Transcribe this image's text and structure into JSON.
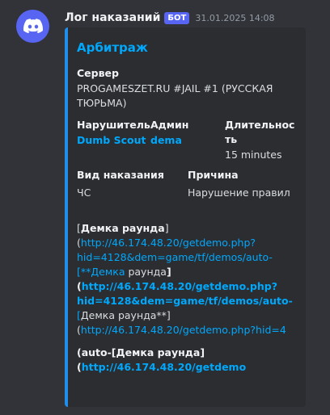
{
  "message": {
    "author": "Лог наказаний",
    "bot_tag": "БОТ",
    "timestamp": "31.01.2025 14:08",
    "accent_color": "#1f8feb",
    "avatar_icon": "discord-logo-icon"
  },
  "embed": {
    "title": "Арбитраж",
    "fields": {
      "server": {
        "name": "Сервер",
        "value_line1": "PROGAMESZET.RU #JAIL #1 (РУССКАЯ",
        "value_line2": "ТЮРЬМА)"
      },
      "violator": {
        "name": "Нарушитель",
        "value": "Dumb Scout"
      },
      "admin": {
        "name": "Админ",
        "value": "dema"
      },
      "duration": {
        "name_line1": "Длительнос",
        "name_line2": "ть",
        "value": "15 minutes"
      },
      "punishment_type": {
        "name": "Вид наказания",
        "value": "ЧС"
      },
      "reason": {
        "name": "Причина",
        "value": "Нарушение правил"
      }
    },
    "description": {
      "l1_a": "[",
      "l1_b": "Демка раунда",
      "l1_c": "]",
      "l2_a": "(",
      "l2_b": "http://46.174.48.20/getdemo.php?",
      "l3": "hid=4128&dem=game/tf/demos/auto-",
      "l4_a": "[**Демка",
      "l4_b": " раунда",
      "l4_c": "]",
      "l5_a": "(",
      "l5_b": "http://46.174.48.20/getdemo.php?",
      "l6": "hid=4128&dem=game/tf/demos/auto-",
      "l7_a": "[",
      "l7_b": "Демка раунда**]",
      "l8_a": "(",
      "l8_b": "http://46.174.48.20/getdemo.php?hid=4",
      "l9_a": "(auto-[",
      "l9_b": "Демка раунда",
      "l9_c": "]",
      "l10_a": "(",
      "l10_b": "http://46.174.48.20/getdemo"
    }
  }
}
